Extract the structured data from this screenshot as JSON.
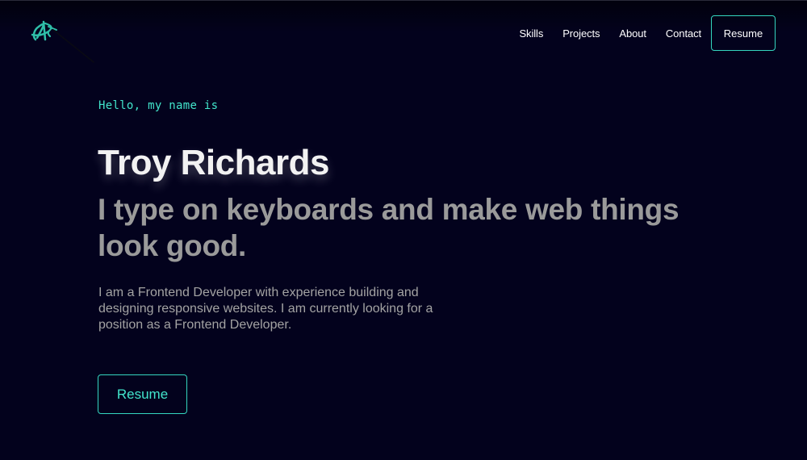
{
  "nav": {
    "links": [
      "Skills",
      "Projects",
      "About",
      "Contact"
    ],
    "resume_label": "Resume"
  },
  "hero": {
    "greeting": "Hello, my name is",
    "name": "Troy Richards",
    "tagline": "I type on keyboards and make web things look good.",
    "bio": "I am a Frontend Developer with experience building and designing responsive websites. I am currently looking for a position as a Frontend Developer.",
    "button_label": "Resume"
  },
  "colors": {
    "background": "#03021d",
    "accent": "#42e6cc",
    "muted": "#9a9a9a"
  },
  "icons": {
    "logo": "signature-logo-icon"
  }
}
